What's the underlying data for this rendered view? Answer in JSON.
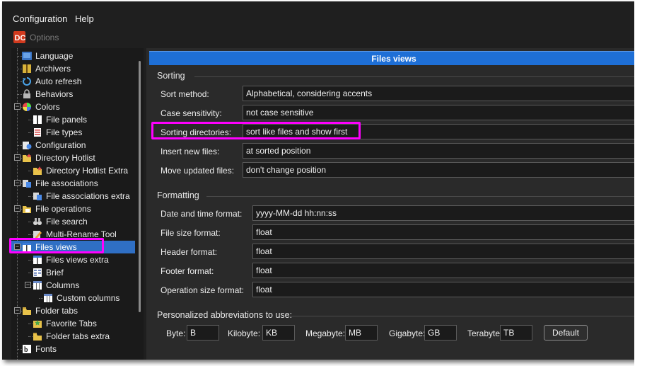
{
  "menu": {
    "configuration": "Configuration",
    "help": "Help"
  },
  "window": {
    "title": "Options"
  },
  "tree": {
    "items": [
      {
        "label": "Language",
        "icon": "language-icon",
        "level": 1
      },
      {
        "label": "Archivers",
        "icon": "archive-icon",
        "level": 1
      },
      {
        "label": "Auto refresh",
        "icon": "refresh-icon",
        "level": 1
      },
      {
        "label": "Behaviors",
        "icon": "lock-icon",
        "level": 1
      },
      {
        "label": "Colors",
        "icon": "color-wheel-icon",
        "level": 1,
        "expander": "-"
      },
      {
        "label": "File panels",
        "icon": "file-panels-icon",
        "level": 2
      },
      {
        "label": "File types",
        "icon": "file-types-icon",
        "level": 2
      },
      {
        "label": "Configuration",
        "icon": "configuration-icon",
        "level": 1
      },
      {
        "label": "Directory Hotlist",
        "icon": "folder-star-icon",
        "level": 1,
        "expander": "-"
      },
      {
        "label": "Directory Hotlist Extra",
        "icon": "folder-star-icon",
        "level": 2
      },
      {
        "label": "File associations",
        "icon": "file-associations-icon",
        "level": 1,
        "expander": "-"
      },
      {
        "label": "File associations extra",
        "icon": "file-associations-icon",
        "level": 2
      },
      {
        "label": "File operations",
        "icon": "file-operations-icon",
        "level": 1,
        "expander": "-"
      },
      {
        "label": "File search",
        "icon": "binoculars-icon",
        "level": 2
      },
      {
        "label": "Multi-Rename Tool",
        "icon": "rename-icon",
        "level": 2
      },
      {
        "label": "Files views",
        "icon": "files-views-icon",
        "level": 1,
        "expander": "-",
        "selected": true
      },
      {
        "label": "Files views extra",
        "icon": "files-views-icon",
        "level": 2
      },
      {
        "label": "Brief",
        "icon": "brief-icon",
        "level": 2
      },
      {
        "label": "Columns",
        "icon": "columns-icon",
        "level": 2,
        "expander": "-"
      },
      {
        "label": "Custom columns",
        "icon": "columns-icon",
        "level": 3
      },
      {
        "label": "Folder tabs",
        "icon": "folder-tabs-icon",
        "level": 1,
        "expander": "-"
      },
      {
        "label": "Favorite Tabs",
        "icon": "favorite-tabs-icon",
        "level": 2
      },
      {
        "label": "Folder tabs extra",
        "icon": "folder-tabs-icon",
        "level": 2
      },
      {
        "label": "Fonts",
        "icon": "fonts-icon",
        "level": 1
      }
    ]
  },
  "page": {
    "header": "Files views",
    "sorting": {
      "title": "Sorting",
      "rows": [
        {
          "label": "Sort method:",
          "value": "Alphabetical, considering accents"
        },
        {
          "label": "Case sensitivity:",
          "value": "not case sensitive"
        },
        {
          "label": "Sorting directories:",
          "value": "sort like files and show first"
        },
        {
          "label": "Insert new files:",
          "value": "at sorted position"
        },
        {
          "label": "Move updated files:",
          "value": "don't change position"
        }
      ]
    },
    "formatting": {
      "title": "Formatting",
      "rows": [
        {
          "label": "Date and time format:",
          "value": "yyyy-MM-dd hh:nn:ss"
        },
        {
          "label": "File size format:",
          "value": "float"
        },
        {
          "label": "Header format:",
          "value": "float"
        },
        {
          "label": "Footer format:",
          "value": "float"
        },
        {
          "label": "Operation size format:",
          "value": "float"
        }
      ]
    },
    "abbreviations": {
      "title": "Personalized abbreviations to use:",
      "fields": [
        {
          "label": "Byte:",
          "value": "B"
        },
        {
          "label": "Kilobyte:",
          "value": "KB"
        },
        {
          "label": "Megabyte:",
          "value": "MB"
        },
        {
          "label": "Gigabyte:",
          "value": "GB"
        },
        {
          "label": "Terabyte:",
          "value": "TB"
        }
      ],
      "default_button": "Default"
    }
  },
  "colors": {
    "accent": "#1e6fd6",
    "selection": "#2f6fc4",
    "highlight": "#ff00ff",
    "background": "#1f1f1f"
  }
}
